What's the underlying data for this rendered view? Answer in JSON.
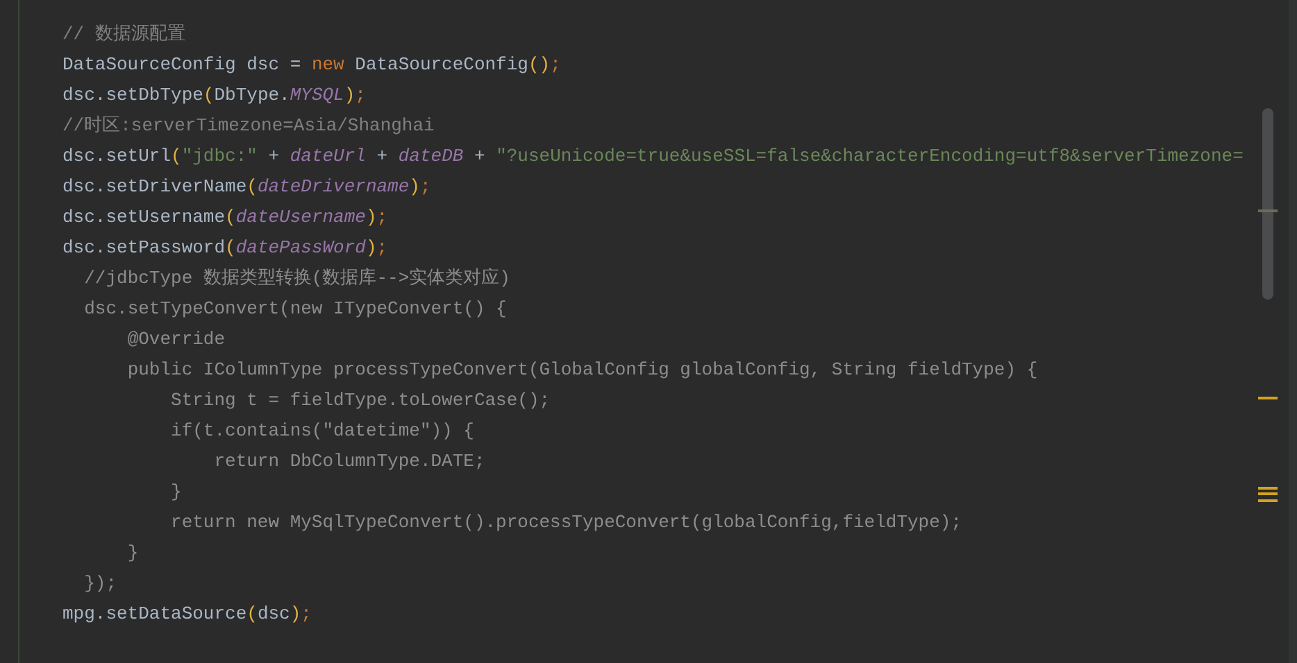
{
  "editor": {
    "lines": [
      {
        "tokens": [
          {
            "kind": "comment",
            "text": "// 数据源配置"
          }
        ]
      },
      {
        "tokens": [
          {
            "kind": "plain",
            "text": "DataSourceConfig dsc = "
          },
          {
            "kind": "keyword",
            "text": "new"
          },
          {
            "kind": "plain",
            "text": " DataSourceConfig"
          },
          {
            "kind": "paren",
            "text": "()"
          },
          {
            "kind": "punct",
            "text": ";"
          }
        ]
      },
      {
        "tokens": [
          {
            "kind": "plain",
            "text": "dsc.setDbType"
          },
          {
            "kind": "paren",
            "text": "("
          },
          {
            "kind": "plain",
            "text": "DbType."
          },
          {
            "kind": "field",
            "text": "MYSQL"
          },
          {
            "kind": "paren",
            "text": ")"
          },
          {
            "kind": "punct",
            "text": ";"
          }
        ]
      },
      {
        "tokens": [
          {
            "kind": "comment",
            "text": "//时区:serverTimezone=Asia/Shanghai"
          }
        ]
      },
      {
        "tokens": [
          {
            "kind": "plain",
            "text": "dsc.setUrl"
          },
          {
            "kind": "paren",
            "text": "("
          },
          {
            "kind": "string",
            "text": "\"jdbc:\""
          },
          {
            "kind": "plain",
            "text": " + "
          },
          {
            "kind": "field",
            "text": "dateUrl"
          },
          {
            "kind": "plain",
            "text": " + "
          },
          {
            "kind": "field",
            "text": "dateDB"
          },
          {
            "kind": "plain",
            "text": " + "
          },
          {
            "kind": "string",
            "text": "\"?useUnicode=true&useSSL=false&characterEncoding=utf8&serverTimezone="
          }
        ]
      },
      {
        "tokens": [
          {
            "kind": "plain",
            "text": "dsc.setDriverName"
          },
          {
            "kind": "paren",
            "text": "("
          },
          {
            "kind": "field",
            "text": "dateDrivername"
          },
          {
            "kind": "paren",
            "text": ")"
          },
          {
            "kind": "punct",
            "text": ";"
          }
        ]
      },
      {
        "tokens": [
          {
            "kind": "plain",
            "text": "dsc.setUsername"
          },
          {
            "kind": "paren",
            "text": "("
          },
          {
            "kind": "field",
            "text": "dateUsername"
          },
          {
            "kind": "paren",
            "text": ")"
          },
          {
            "kind": "punct",
            "text": ";"
          }
        ]
      },
      {
        "tokens": [
          {
            "kind": "plain",
            "text": "dsc.setPassword"
          },
          {
            "kind": "paren",
            "text": "("
          },
          {
            "kind": "field",
            "text": "datePassWord"
          },
          {
            "kind": "paren",
            "text": ")"
          },
          {
            "kind": "punct",
            "text": ";"
          }
        ]
      },
      {
        "tokens": [
          {
            "kind": "dim",
            "text": "  //jdbcType 数据类型转换(数据库-->实体类对应)"
          }
        ]
      },
      {
        "tokens": [
          {
            "kind": "dim",
            "text": "  dsc.setTypeConvert(new ITypeConvert() {"
          }
        ]
      },
      {
        "tokens": [
          {
            "kind": "dim",
            "text": "      @Override"
          }
        ]
      },
      {
        "tokens": [
          {
            "kind": "dim",
            "text": "      public IColumnType processTypeConvert(GlobalConfig globalConfig, String fieldType) {"
          }
        ]
      },
      {
        "tokens": [
          {
            "kind": "dim",
            "text": "          String t = fieldType.toLowerCase();"
          }
        ]
      },
      {
        "tokens": [
          {
            "kind": "dim",
            "text": "          if(t.contains(\"datetime\")) {"
          }
        ]
      },
      {
        "tokens": [
          {
            "kind": "dim",
            "text": "              return DbColumnType.DATE;"
          }
        ]
      },
      {
        "tokens": [
          {
            "kind": "dim",
            "text": "          }"
          }
        ]
      },
      {
        "tokens": [
          {
            "kind": "dim",
            "text": "          return new MySqlTypeConvert().processTypeConvert(globalConfig,fieldType);"
          }
        ]
      },
      {
        "tokens": [
          {
            "kind": "dim",
            "text": "      }"
          }
        ]
      },
      {
        "tokens": [
          {
            "kind": "dim",
            "text": "  });"
          }
        ]
      },
      {
        "tokens": [
          {
            "kind": "plain",
            "text": "mpg.setDataSource"
          },
          {
            "kind": "paren",
            "text": "("
          },
          {
            "kind": "plain",
            "text": "dsc"
          },
          {
            "kind": "paren",
            "text": ")"
          },
          {
            "kind": "punct",
            "text": ";"
          }
        ]
      }
    ]
  }
}
